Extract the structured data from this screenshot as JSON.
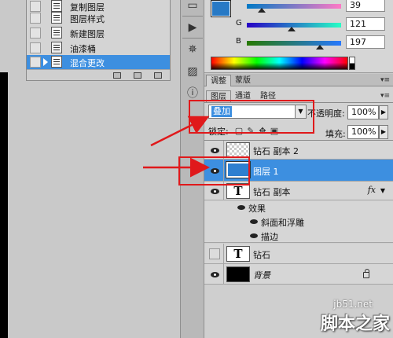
{
  "history": {
    "items": [
      {
        "label": "复制图层",
        "selected": false
      },
      {
        "label": "图层样式",
        "selected": false
      },
      {
        "label": "新建图层",
        "selected": false
      },
      {
        "label": "油漆桶",
        "selected": false
      },
      {
        "label": "混合更改",
        "selected": true
      }
    ]
  },
  "color": {
    "foreground": "#2779c5",
    "channels": [
      {
        "label": "",
        "value": "39",
        "fraction": 0.153
      },
      {
        "label": "G",
        "value": "121",
        "fraction": 0.475
      },
      {
        "label": "B",
        "value": "197",
        "fraction": 0.773
      }
    ]
  },
  "adjust_tabs": [
    "调整",
    "蒙版"
  ],
  "layers": {
    "tabs": [
      "图层",
      "通道",
      "路径"
    ],
    "blend_mode": "叠加",
    "opacity_label": "不透明度:",
    "opacity_value": "100%",
    "lock_label": "锁定:",
    "fill_label": "填充:",
    "fill_value": "100%",
    "rows": [
      {
        "name": "钻石 副本 2",
        "thumb": "checker",
        "visible": true,
        "selected": false
      },
      {
        "name": "图层 1",
        "thumb": "blue",
        "visible": true,
        "selected": true
      },
      {
        "name": "钻石 副本",
        "thumb": "text",
        "visible": true,
        "selected": false,
        "fx": "fx"
      },
      {
        "name": "钻石",
        "thumb": "text",
        "visible": false,
        "selected": false
      },
      {
        "name": "背景",
        "thumb": "black",
        "visible": true,
        "selected": false,
        "locked": true
      }
    ],
    "effects_label": "效果",
    "effects": [
      "斜面和浮雕",
      "描边"
    ]
  },
  "watermark": {
    "url": "jb51.net",
    "name": "脚本之家"
  },
  "colors": {
    "highlight": "#3d8fe0",
    "annotation_red": "#e0191b"
  }
}
